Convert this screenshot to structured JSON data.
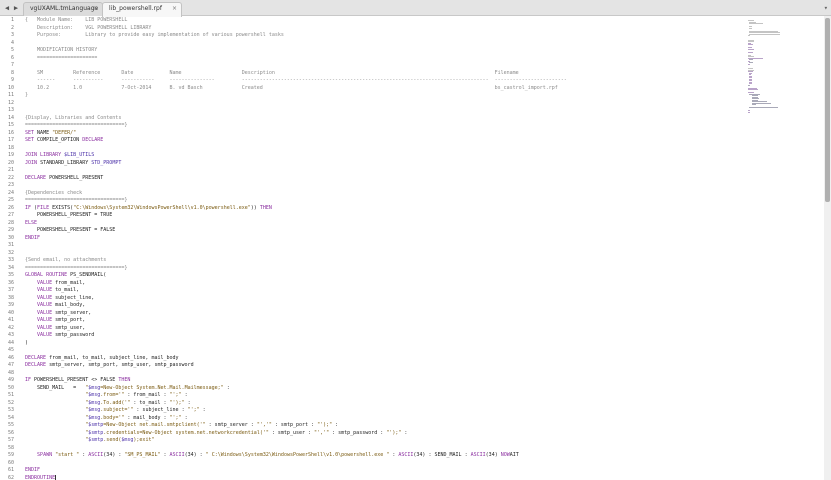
{
  "tabbar": {
    "back_arrow": "◀",
    "forward_arrow": "▶",
    "dropdown_arrow": "▾",
    "tabs": [
      {
        "label": "vgUXAML.tmLanguage",
        "close": "×",
        "active": false
      },
      {
        "label": "lib_powershell.rpf",
        "close": "×",
        "active": true
      }
    ]
  },
  "editor": {
    "line_numbers": [
      "1",
      "2",
      "3",
      "4",
      "5",
      "6",
      "7",
      "8",
      "9",
      "10",
      "11",
      "12",
      "13",
      "14",
      "15",
      "16",
      "17",
      "18",
      "19",
      "20",
      "21",
      "22",
      "23",
      "24",
      "25",
      "26",
      "27",
      "28",
      "29",
      "30",
      "31",
      "32",
      "33",
      "34",
      "35",
      "36",
      "37",
      "38",
      "39",
      "40",
      "41",
      "42",
      "43",
      "44",
      "45",
      "46",
      "47",
      "48",
      "49",
      "50",
      "51",
      "52",
      "53",
      "54",
      "55",
      "56",
      "57",
      "58",
      "59",
      "60",
      "61",
      "62"
    ],
    "lines": [
      [
        [
          "c",
          "{   Module Name:    LIB POWERSHELL"
        ]
      ],
      [
        [
          "c",
          "    Description:    VGL POWERSHELL LIBRARY"
        ]
      ],
      [
        [
          "c",
          "    Purpose:        Library to provide easy implementation of various powershell tasks"
        ]
      ],
      [],
      [
        [
          "c",
          "    MODIFICATION HISTORY"
        ]
      ],
      [
        [
          "c",
          "    ===================="
        ]
      ],
      [],
      [
        [
          "c",
          "    SM          Reference       Date            Name                    Description                                                                         Filename"
        ]
      ],
      [
        [
          "c",
          "    ------      ----------      -----------     ---------------         ----------------------------------------------------------------------------------  ------------------------"
        ]
      ],
      [
        [
          "c",
          "    10.2        1.0             7-Oct-2014      B. vd Basch             Created                                                                             bs_castrol_import.rpf"
        ]
      ],
      [
        [
          "c",
          "}"
        ]
      ],
      [],
      [],
      [
        [
          "c",
          "{Display, Libraries and Contents"
        ]
      ],
      [
        [
          "c",
          "=================================}"
        ]
      ],
      [
        [
          "k",
          "SET "
        ],
        [
          "p",
          "NAME "
        ],
        [
          "s",
          "\"DEFER/\""
        ]
      ],
      [
        [
          "k",
          "SET "
        ],
        [
          "p",
          "COMPILE_OPTION "
        ],
        [
          "k",
          "DECLARE"
        ]
      ],
      [],
      [
        [
          "k",
          "JOIN LIBRARY "
        ],
        [
          "v",
          "$LIB_UTILS"
        ]
      ],
      [
        [
          "k",
          "JOIN "
        ],
        [
          "p",
          "STANDARD_LIBRARY "
        ],
        [
          "v",
          "STD_PROMPT"
        ]
      ],
      [],
      [
        [
          "k",
          "DECLARE "
        ],
        [
          "p",
          "POWERSHELL_PRESENT"
        ]
      ],
      [],
      [
        [
          "c",
          "{Dependencies check"
        ]
      ],
      [
        [
          "c",
          "=================================}"
        ]
      ],
      [
        [
          "k",
          "IF "
        ],
        [
          "p",
          "("
        ],
        [
          "k",
          "FILE "
        ],
        [
          "p",
          "EXISTS("
        ],
        [
          "s",
          "\"C:\\Windows\\System32\\WindowsPowerShell\\v1.0\\powershell.exe\""
        ],
        [
          "p",
          ")) "
        ],
        [
          "k",
          "THEN"
        ]
      ],
      [
        [
          "p",
          "    POWERSHELL_PRESENT = TRUE"
        ]
      ],
      [
        [
          "k",
          "ELSE"
        ]
      ],
      [
        [
          "p",
          "    POWERSHELL_PRESENT = FALSE"
        ]
      ],
      [
        [
          "k",
          "ENDIF"
        ]
      ],
      [],
      [],
      [
        [
          "c",
          "{Send email, no attachments"
        ]
      ],
      [
        [
          "c",
          "=================================}"
        ]
      ],
      [
        [
          "k",
          "GLOBAL ROUTINE "
        ],
        [
          "p",
          "PS_SENDMAIL("
        ]
      ],
      [
        [
          "k",
          "    VALUE "
        ],
        [
          "p",
          "from_mail,"
        ]
      ],
      [
        [
          "k",
          "    VALUE "
        ],
        [
          "p",
          "to_mail,"
        ]
      ],
      [
        [
          "k",
          "    VALUE "
        ],
        [
          "p",
          "subject_line,"
        ]
      ],
      [
        [
          "k",
          "    VALUE "
        ],
        [
          "p",
          "mail_body,"
        ]
      ],
      [
        [
          "k",
          "    VALUE "
        ],
        [
          "p",
          "smtp_server,"
        ]
      ],
      [
        [
          "k",
          "    VALUE "
        ],
        [
          "p",
          "smtp_port,"
        ]
      ],
      [
        [
          "k",
          "    VALUE "
        ],
        [
          "p",
          "smtp_user,"
        ]
      ],
      [
        [
          "k",
          "    VALUE "
        ],
        [
          "p",
          "smtp_password"
        ]
      ],
      [
        [
          "p",
          ")"
        ]
      ],
      [],
      [
        [
          "k",
          "DECLARE "
        ],
        [
          "p",
          "from_mail, to_mail, subject_line, mail_body"
        ]
      ],
      [
        [
          "k",
          "DECLARE "
        ],
        [
          "p",
          "smtp_server, smtp_port, smtp_user, smtp_password"
        ]
      ],
      [],
      [
        [
          "k",
          "IF "
        ],
        [
          "p",
          "POWERSHELL_PRESENT <> FALSE "
        ],
        [
          "k",
          "THEN"
        ]
      ],
      [
        [
          "p",
          "    SEND_MAIL   =   "
        ],
        [
          "s",
          "\""
        ],
        [
          "v",
          "$msg"
        ],
        [
          "s",
          "=New-Object System.Net.Mail.Mailmessage;\""
        ],
        [
          "p",
          " :"
        ]
      ],
      [
        [
          "p",
          "                    "
        ],
        [
          "s",
          "\""
        ],
        [
          "v",
          "$msg"
        ],
        [
          "s",
          ".from='\""
        ],
        [
          "p",
          " : from_mail : "
        ],
        [
          "s",
          "\"';\""
        ],
        [
          "p",
          " :"
        ]
      ],
      [
        [
          "p",
          "                    "
        ],
        [
          "s",
          "\""
        ],
        [
          "v",
          "$msg"
        ],
        [
          "s",
          ".To.add('\""
        ],
        [
          "p",
          " : to_mail : "
        ],
        [
          "s",
          "\"');\""
        ],
        [
          "p",
          " :"
        ]
      ],
      [
        [
          "p",
          "                    "
        ],
        [
          "s",
          "\""
        ],
        [
          "v",
          "$msg"
        ],
        [
          "s",
          ".subject='\""
        ],
        [
          "p",
          " : subject_line : "
        ],
        [
          "s",
          "\"';\""
        ],
        [
          "p",
          " :"
        ]
      ],
      [
        [
          "p",
          "                    "
        ],
        [
          "s",
          "\""
        ],
        [
          "v",
          "$msg"
        ],
        [
          "s",
          ".body='\""
        ],
        [
          "p",
          " : mail_body : "
        ],
        [
          "s",
          "\"';\""
        ],
        [
          "p",
          " :"
        ]
      ],
      [
        [
          "p",
          "                    "
        ],
        [
          "s",
          "\""
        ],
        [
          "v",
          "$smtp"
        ],
        [
          "s",
          "=New-Object net.mail.smtpclient('\""
        ],
        [
          "p",
          " : smtp_server : "
        ],
        [
          "s",
          "\"','\""
        ],
        [
          "p",
          " : smtp_port : "
        ],
        [
          "s",
          "\"');\""
        ],
        [
          "p",
          " :"
        ]
      ],
      [
        [
          "p",
          "                    "
        ],
        [
          "s",
          "\""
        ],
        [
          "v",
          "$smtp"
        ],
        [
          "s",
          ".credentials=New-Object system.net.networkcredential('\""
        ],
        [
          "p",
          " : smtp_user : "
        ],
        [
          "s",
          "\"','\""
        ],
        [
          "p",
          " : smtp_password : "
        ],
        [
          "s",
          "\"');\""
        ],
        [
          "p",
          " :"
        ]
      ],
      [
        [
          "p",
          "                    "
        ],
        [
          "s",
          "\""
        ],
        [
          "v",
          "$smtp"
        ],
        [
          "s",
          ".send("
        ],
        [
          "v",
          "$msg"
        ],
        [
          "s",
          ");exit\""
        ]
      ],
      [],
      [
        [
          "p",
          "    "
        ],
        [
          "k",
          "SPAWN "
        ],
        [
          "s",
          "\"start \""
        ],
        [
          "p",
          " : "
        ],
        [
          "k",
          "ASCII"
        ],
        [
          "p",
          "(34) : "
        ],
        [
          "s",
          "\"SM_PS_MAIL\""
        ],
        [
          "p",
          " : "
        ],
        [
          "k",
          "ASCII"
        ],
        [
          "p",
          "(34) : "
        ],
        [
          "s",
          "\" C:\\Windows\\System32\\WindowsPowerShell\\v1.0\\powershell.exe \""
        ],
        [
          "p",
          " : "
        ],
        [
          "k",
          "ASCII"
        ],
        [
          "p",
          "(34) : SEND_MAIL : "
        ],
        [
          "k",
          "ASCII"
        ],
        [
          "p",
          "(34) "
        ],
        [
          "k",
          "NOW"
        ],
        [
          "p",
          "AIT"
        ]
      ],
      [],
      [
        [
          "k",
          "ENDIF"
        ]
      ],
      [
        [
          "k",
          "ENDROUTINE"
        ]
      ]
    ]
  },
  "colors": {
    "comment": "#8a8a8a",
    "keyword": "#8b2fa0",
    "string": "#7a5a10",
    "variable": "#4a2fa8",
    "plain": "#222222"
  }
}
